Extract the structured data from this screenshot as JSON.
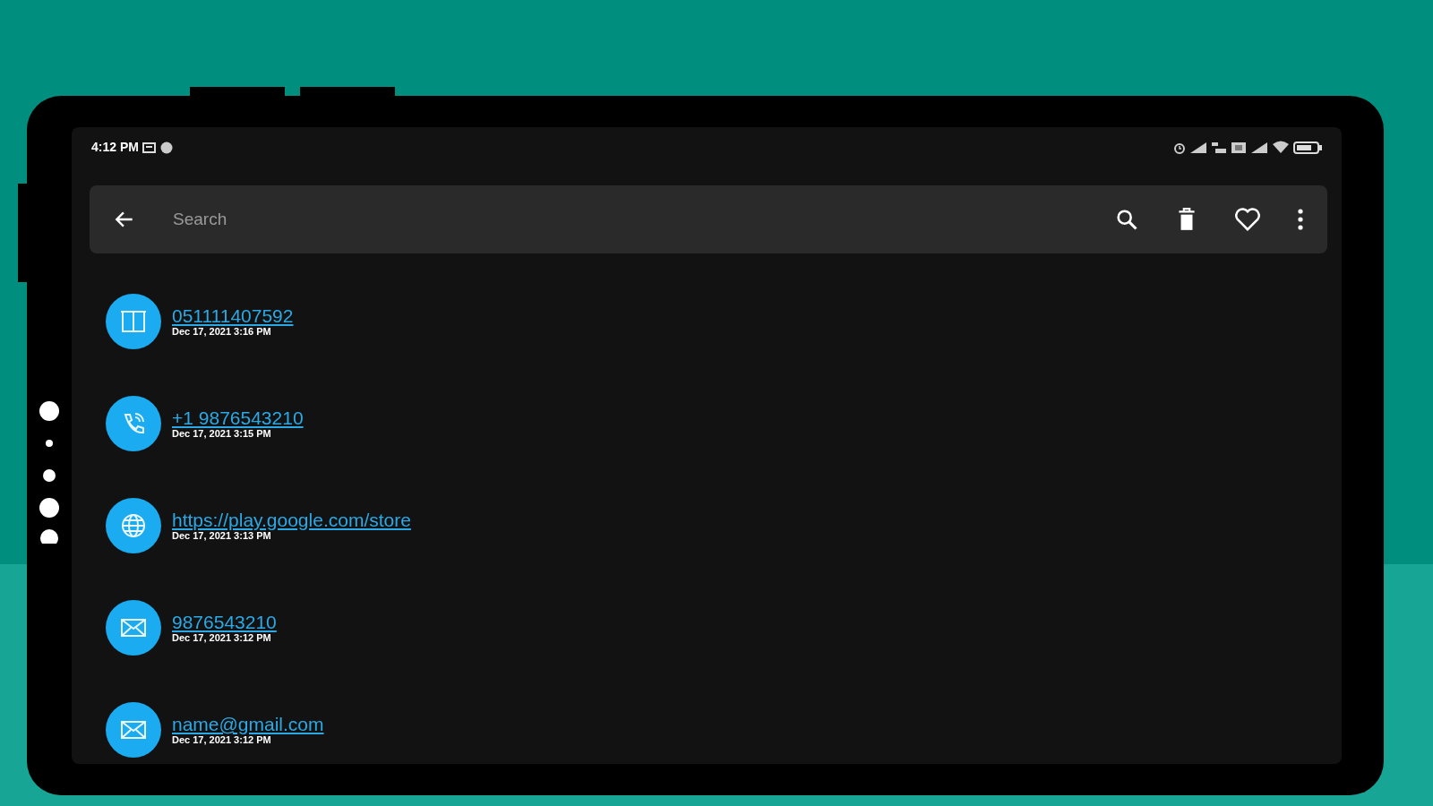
{
  "status_bar": {
    "time": "4:12 PM"
  },
  "search": {
    "placeholder": "Search"
  },
  "history": [
    {
      "kind": "product",
      "text": "051111407592",
      "date": "Dec 17, 2021 3:16 PM"
    },
    {
      "kind": "phone",
      "text": "+1 9876543210",
      "date": "Dec 17, 2021 3:15 PM"
    },
    {
      "kind": "url",
      "text": "https://play.google.com/store",
      "date": "Dec 17, 2021 3:13 PM"
    },
    {
      "kind": "sms",
      "text": "9876543210",
      "date": "Dec 17, 2021 3:12 PM"
    },
    {
      "kind": "email",
      "text": "name@gmail.com",
      "date": "Dec 17, 2021 3:12 PM"
    }
  ]
}
